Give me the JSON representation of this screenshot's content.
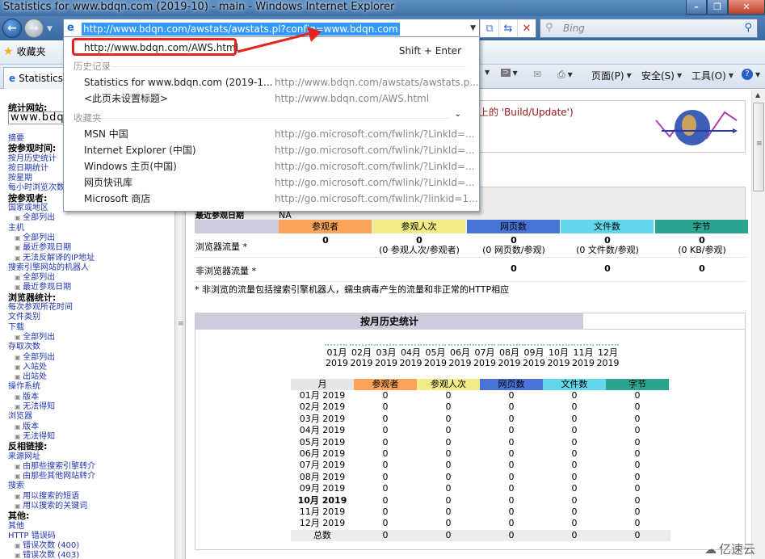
{
  "window": {
    "title": "Statistics for www.bdqn.com (2019-10) - main - Windows Internet Explorer",
    "controls": [
      "minimize",
      "restore",
      "close"
    ]
  },
  "navbar": {
    "address_url": "http://www.bdqn.com/awstats/awstats.pl?config=www.bdqn.com",
    "search_placeholder": "Bing"
  },
  "favorites_bar": {
    "favorites_label": "收藏夹"
  },
  "tab": {
    "label": "Statistics"
  },
  "command_bar": {
    "page": "页面(P)",
    "safety": "安全(S)",
    "tools": "工具(O)"
  },
  "dropdown": {
    "suggestion": {
      "url": "http://www.bdqn.com/AWS.html",
      "shortcut": "Shift + Enter"
    },
    "history_label": "历史记录",
    "history": [
      {
        "title": "Statistics for www.bdqn.com (2019-1...",
        "url": "http://www.bdqn.com/awstats/awstats.p..."
      },
      {
        "title": "<此页未设置标题>",
        "url": "http://www.bdqn.com/AWS.html"
      }
    ],
    "favorites_label": "收藏夹",
    "favorites": [
      {
        "title": "MSN 中国",
        "url": "http://go.microsoft.com/fwlink/?LinkId=..."
      },
      {
        "title": "Internet Explorer (中国)",
        "url": "http://go.microsoft.com/fwlink/?LinkId=..."
      },
      {
        "title": "Windows 主页(中国)",
        "url": "http://go.microsoft.com/fwlink/?LinkId=..."
      },
      {
        "title": "网页快讯库",
        "url": "http://go.microsoft.com/fwlink/?LinkId=..."
      },
      {
        "title": "Microsoft 商店",
        "url": "http://go.microsoft.com/fwlink/?linkid=1..."
      }
    ]
  },
  "sidebar": {
    "site_label": "统计网站:",
    "site_value": "www.bdqn.com",
    "items": [
      {
        "type": "l",
        "text": "摘要"
      },
      {
        "type": "h",
        "text": "按参观时间:"
      },
      {
        "type": "l",
        "text": "按月历史统计"
      },
      {
        "type": "l",
        "text": "按日期统计"
      },
      {
        "type": "l",
        "text": "按星期"
      },
      {
        "type": "l",
        "text": "每小时浏览次数"
      },
      {
        "type": "h",
        "text": "按参观者:"
      },
      {
        "type": "l",
        "text": "国家或地区"
      },
      {
        "type": "s",
        "text": "全部列出"
      },
      {
        "type": "l",
        "text": "主机"
      },
      {
        "type": "s",
        "text": "全部列出"
      },
      {
        "type": "s",
        "text": "最近参观日期"
      },
      {
        "type": "s",
        "text": "无法反解译的IP地址"
      },
      {
        "type": "l",
        "text": "搜索引擎网站的机器人"
      },
      {
        "type": "s",
        "text": "全部列出"
      },
      {
        "type": "s",
        "text": "最近参观日期"
      },
      {
        "type": "h",
        "text": "浏览器统计:"
      },
      {
        "type": "l",
        "text": "每次参观所花时间"
      },
      {
        "type": "l",
        "text": "文件类别"
      },
      {
        "type": "l",
        "text": "下载"
      },
      {
        "type": "s",
        "text": "全部列出"
      },
      {
        "type": "l",
        "text": "存取次数"
      },
      {
        "type": "s",
        "text": "全部列出"
      },
      {
        "type": "s",
        "text": "入站处"
      },
      {
        "type": "s",
        "text": "出站处"
      },
      {
        "type": "l",
        "text": "操作系统"
      },
      {
        "type": "s",
        "text": "版本"
      },
      {
        "type": "s",
        "text": "无法得知"
      },
      {
        "type": "l",
        "text": "浏览器"
      },
      {
        "type": "s",
        "text": "版本"
      },
      {
        "type": "s",
        "text": "无法得知"
      },
      {
        "type": "h",
        "text": "反相链接:"
      },
      {
        "type": "l",
        "text": "来源网址"
      },
      {
        "type": "s",
        "text": "由那些搜索引擎转介"
      },
      {
        "type": "s",
        "text": "由那些其他网站转介"
      },
      {
        "type": "l",
        "text": "搜索"
      },
      {
        "type": "s",
        "text": "用以搜索的短语"
      },
      {
        "type": "s",
        "text": "用以搜索的关键词"
      },
      {
        "type": "h",
        "text": "其他:"
      },
      {
        "type": "l",
        "text": "其他"
      },
      {
        "type": "l",
        "text": "HTTP 错误码"
      },
      {
        "type": "s",
        "text": "错误次数 (400)"
      },
      {
        "type": "s",
        "text": "错误次数 (403)"
      }
    ]
  },
  "main": {
    "update_notice": "nl上的 'Build/Update')",
    "summary": {
      "last_visit_label": "最近参观日期",
      "last_visit_value": "NA",
      "columns": [
        "参观者",
        "参观人次",
        "网页数",
        "文件数",
        "字节"
      ],
      "column_colors": [
        "#f9a35c",
        "#f2eb8a",
        "#4a73d8",
        "#62d7ea",
        "#2aa48e"
      ],
      "rows": [
        {
          "label": "浏览器流量 *",
          "values": [
            "0",
            "0",
            "0",
            "0",
            "0"
          ],
          "subs": [
            "",
            "(0 参观人次/参观者)",
            "(0 网页数/参观)",
            "(0 文件数/参观)",
            "(0 KB/参观)"
          ]
        },
        {
          "label": "非浏览器流量 *",
          "values": [
            "",
            "",
            "0",
            "0",
            "0"
          ]
        }
      ],
      "footnote": "* 非浏览的流量包括搜索引擎机器人，蠕虫病毒产生的流量和非正常的HTTP相应"
    },
    "history": {
      "title": "按月历史统计",
      "chart_months": [
        {
          "m": "01月",
          "y": "2019"
        },
        {
          "m": "02月",
          "y": "2019"
        },
        {
          "m": "03月",
          "y": "2019"
        },
        {
          "m": "04月",
          "y": "2019"
        },
        {
          "m": "05月",
          "y": "2019"
        },
        {
          "m": "06月",
          "y": "2019"
        },
        {
          "m": "07月",
          "y": "2019"
        },
        {
          "m": "08月",
          "y": "2019"
        },
        {
          "m": "09月",
          "y": "2019"
        },
        {
          "m": "10月",
          "y": "2019",
          "current": true
        },
        {
          "m": "11月",
          "y": "2019"
        },
        {
          "m": "12月",
          "y": "2019"
        }
      ],
      "table_headers": [
        "月",
        "参观者",
        "参观人次",
        "网页数",
        "文件数",
        "字节"
      ],
      "rows": [
        {
          "month": "01月 2019",
          "values": [
            "0",
            "0",
            "0",
            "0",
            "0"
          ]
        },
        {
          "month": "02月 2019",
          "values": [
            "0",
            "0",
            "0",
            "0",
            "0"
          ]
        },
        {
          "month": "03月 2019",
          "values": [
            "0",
            "0",
            "0",
            "0",
            "0"
          ]
        },
        {
          "month": "04月 2019",
          "values": [
            "0",
            "0",
            "0",
            "0",
            "0"
          ]
        },
        {
          "month": "05月 2019",
          "values": [
            "0",
            "0",
            "0",
            "0",
            "0"
          ]
        },
        {
          "month": "06月 2019",
          "values": [
            "0",
            "0",
            "0",
            "0",
            "0"
          ]
        },
        {
          "month": "07月 2019",
          "values": [
            "0",
            "0",
            "0",
            "0",
            "0"
          ]
        },
        {
          "month": "08月 2019",
          "values": [
            "0",
            "0",
            "0",
            "0",
            "0"
          ]
        },
        {
          "month": "09月 2019",
          "values": [
            "0",
            "0",
            "0",
            "0",
            "0"
          ]
        },
        {
          "month": "10月 2019",
          "values": [
            "0",
            "0",
            "0",
            "0",
            "0"
          ],
          "current": true
        },
        {
          "month": "11月 2019",
          "values": [
            "0",
            "0",
            "0",
            "0",
            "0"
          ]
        },
        {
          "month": "12月 2019",
          "values": [
            "0",
            "0",
            "0",
            "0",
            "0"
          ]
        },
        {
          "month": "总数",
          "values": [
            "0",
            "0",
            "0",
            "0",
            "0"
          ],
          "total": true
        }
      ]
    }
  },
  "watermark": "亿速云"
}
